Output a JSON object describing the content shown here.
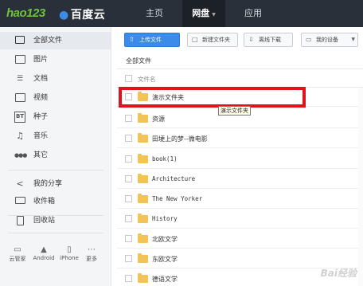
{
  "header": {
    "logo_hao": "hao123",
    "logo_baidu": "百度云",
    "nav": [
      "主页",
      "网盘",
      "应用"
    ],
    "active_nav": "网盘"
  },
  "sidebar": {
    "items": [
      {
        "label": "全部文件",
        "icon": "folder-icon"
      },
      {
        "label": "图片",
        "icon": "image-icon"
      },
      {
        "label": "文档",
        "icon": "document-icon"
      },
      {
        "label": "视频",
        "icon": "video-icon"
      },
      {
        "label": "种子",
        "icon": "bt-icon",
        "icon_text": "BT"
      },
      {
        "label": "音乐",
        "icon": "music-icon"
      },
      {
        "label": "其它",
        "icon": "more-icon"
      }
    ],
    "share": [
      {
        "label": "我的分享",
        "icon": "share-icon"
      },
      {
        "label": "收件箱",
        "icon": "inbox-icon"
      }
    ],
    "trash": {
      "label": "回收站",
      "icon": "trash-icon"
    },
    "devices": [
      "云管家",
      "Android",
      "iPhone",
      "更多"
    ]
  },
  "toolbar": {
    "upload": "上传文件",
    "new_folder": "新建文件夹",
    "offline": "离线下载",
    "my_devices": "我的设备"
  },
  "breadcrumb": "全部文件",
  "table": {
    "column": "文件名",
    "rows": [
      "演示文件夹",
      "资源",
      "田埂上的梦--微电影",
      "book(1)",
      "Architecture",
      "The New Yorker",
      "History",
      "北欧文学",
      "东欧文学",
      "德语文学"
    ],
    "highlighted_row": "演示文件夹",
    "tooltip": "演示文件夹"
  },
  "watermark": "Bai经验",
  "colors": {
    "topbar": "#2a3039",
    "accent": "#3b8be8",
    "highlight": "#e0121b",
    "folder": "#f3c355"
  }
}
